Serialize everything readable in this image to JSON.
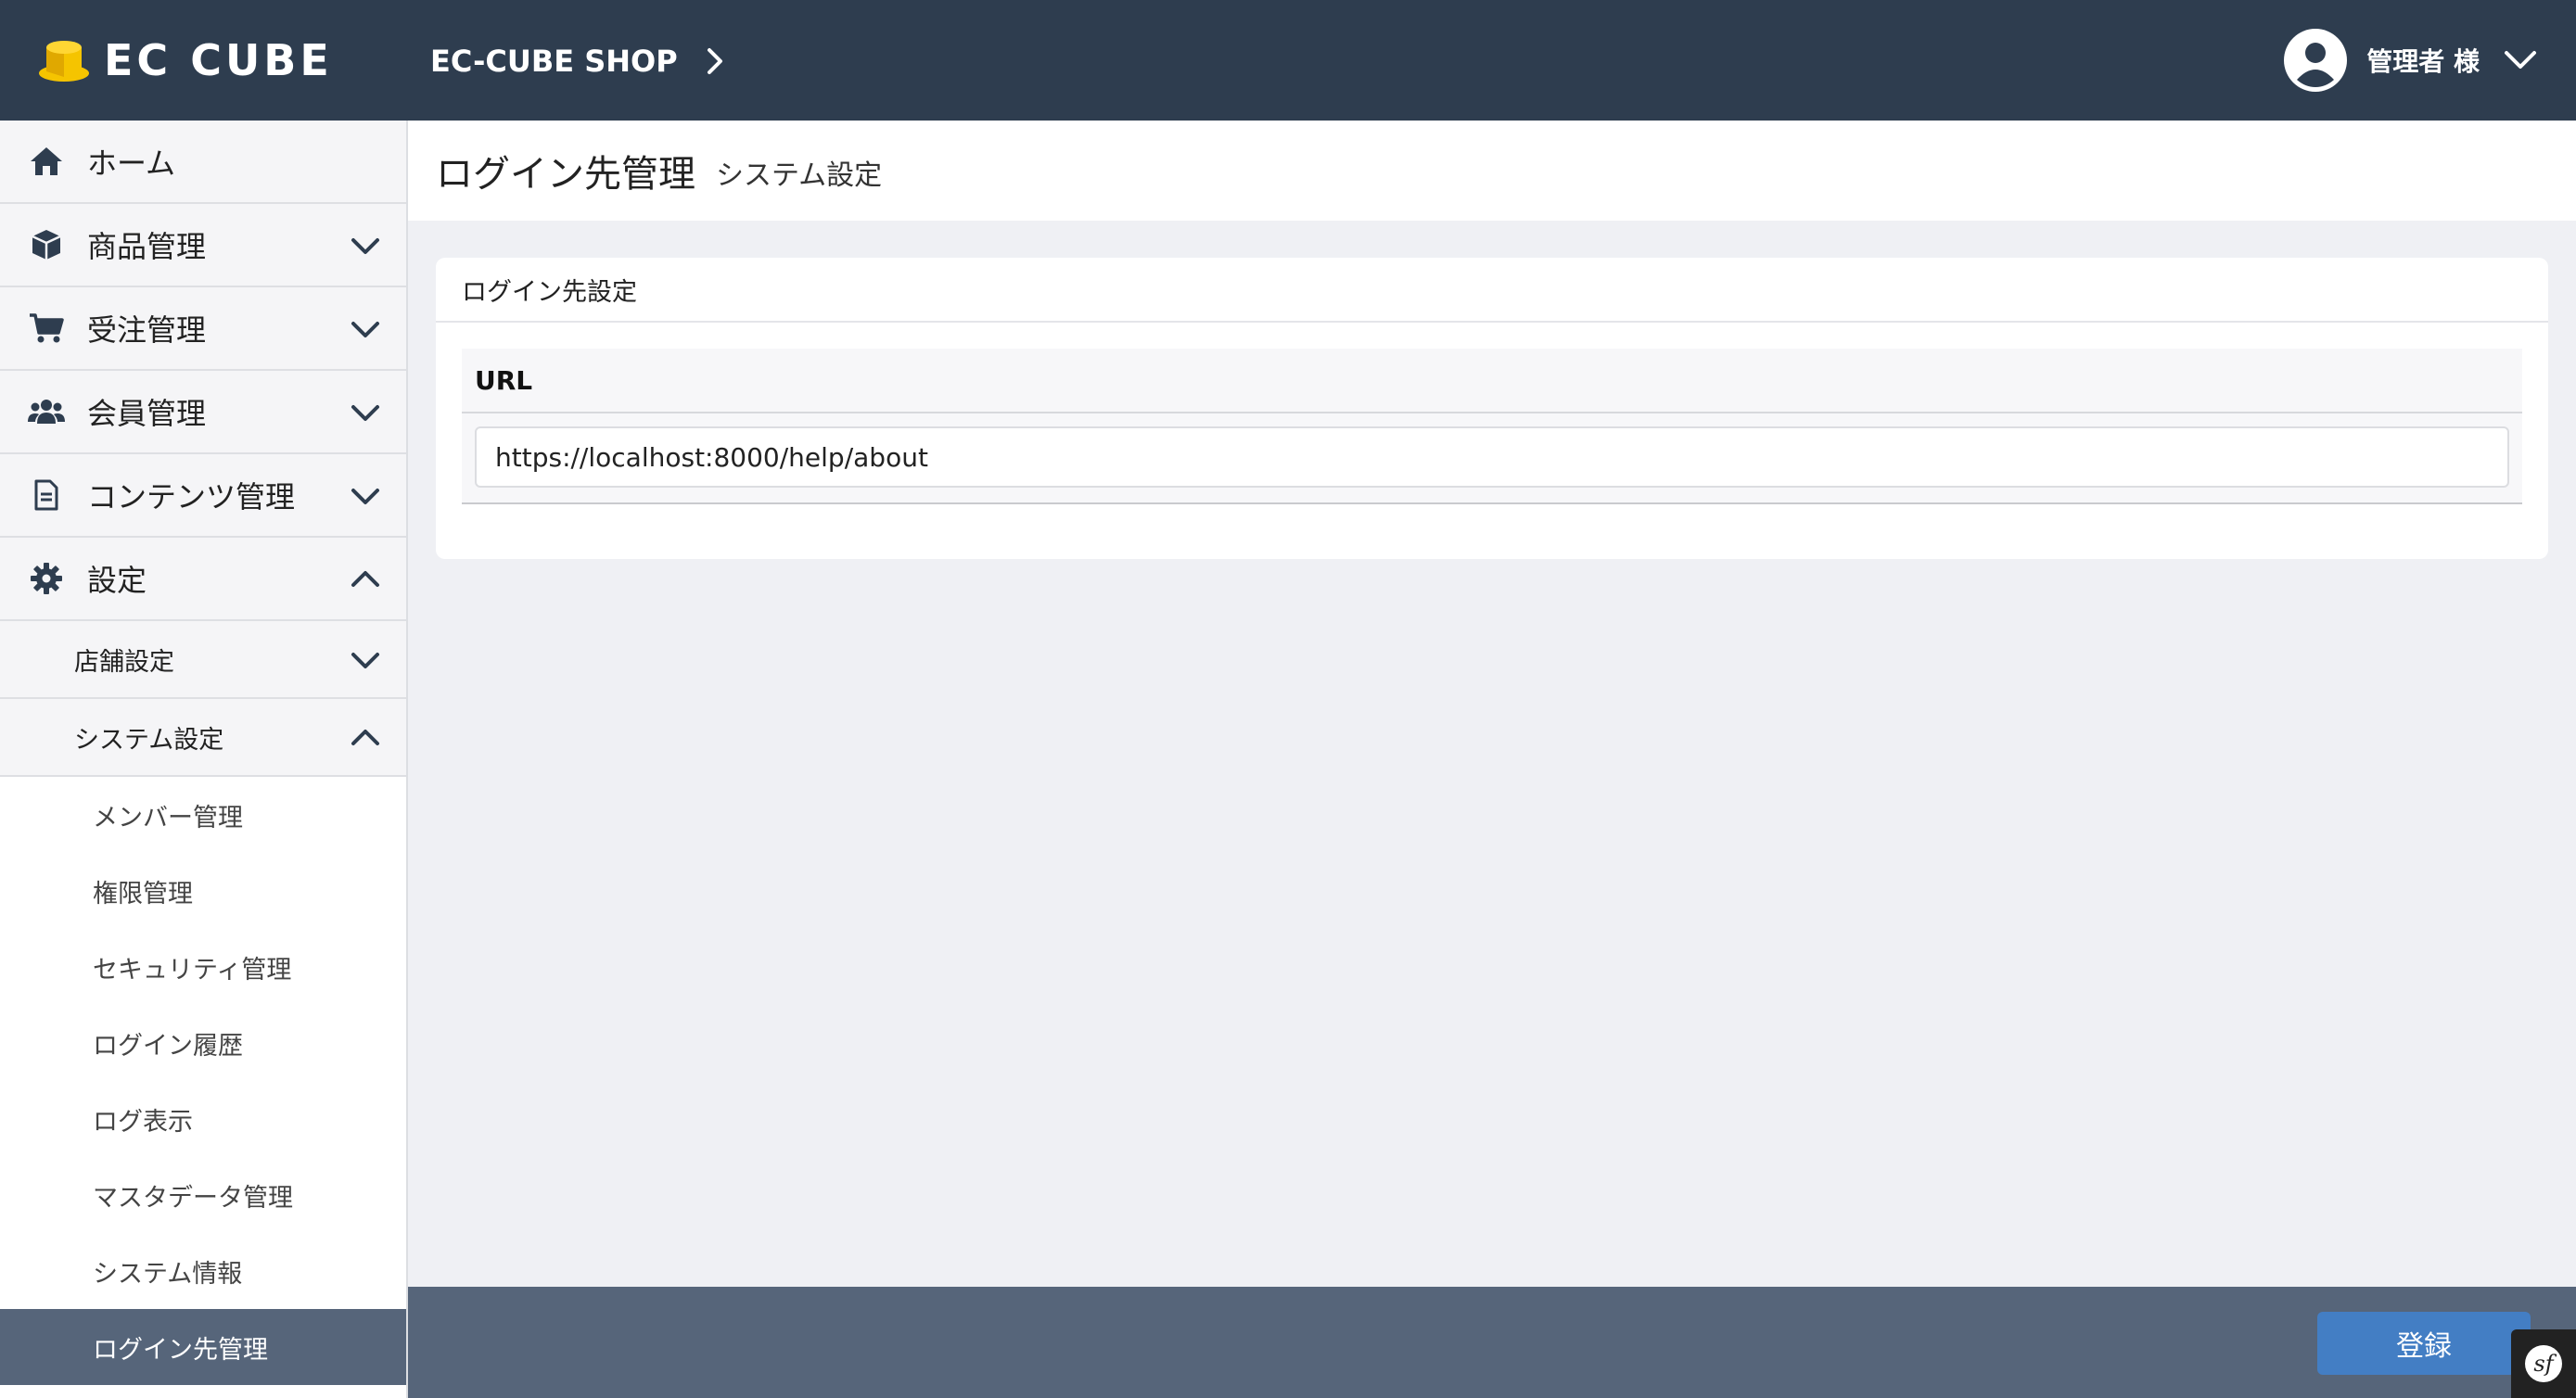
{
  "header": {
    "logo_text": "EC CUBE",
    "shop_name": "EC-CUBE SHOP",
    "user_name": "管理者 様"
  },
  "sidebar": {
    "items": [
      {
        "label": "ホーム",
        "icon": "home-icon"
      },
      {
        "label": "商品管理",
        "icon": "box-icon"
      },
      {
        "label": "受注管理",
        "icon": "cart-icon"
      },
      {
        "label": "会員管理",
        "icon": "users-icon"
      },
      {
        "label": "コンテンツ管理",
        "icon": "file-icon"
      },
      {
        "label": "設定",
        "icon": "gear-icon"
      }
    ],
    "sub_items": [
      {
        "label": "店舗設定"
      },
      {
        "label": "システム設定"
      }
    ],
    "leaves": [
      {
        "label": "メンバー管理"
      },
      {
        "label": "権限管理"
      },
      {
        "label": "セキュリティ管理"
      },
      {
        "label": "ログイン履歴"
      },
      {
        "label": "ログ表示"
      },
      {
        "label": "マスタデータ管理"
      },
      {
        "label": "システム情報"
      },
      {
        "label": "ログイン先管理"
      }
    ]
  },
  "page": {
    "title": "ログイン先管理",
    "subtitle": "システム設定"
  },
  "card": {
    "title": "ログイン先設定",
    "field_label": "URL",
    "url_value": "https://localhost:8000/help/about"
  },
  "footer": {
    "register_label": "登録"
  },
  "colors": {
    "header_bg": "#2e3d4f",
    "active_item_bg": "#56657a",
    "primary_button": "#437ec4",
    "logo_yellow": "#f5c400"
  }
}
